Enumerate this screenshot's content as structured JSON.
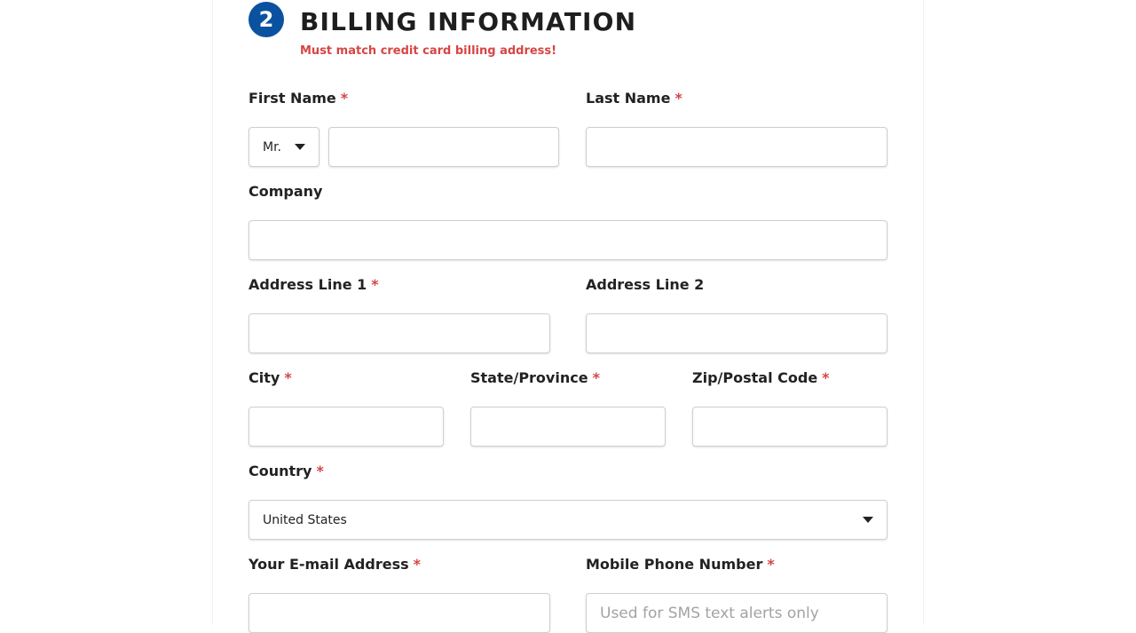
{
  "section": {
    "step": "2",
    "title": "BILLING INFORMATION",
    "note": "Must match credit card billing address!"
  },
  "required_marker": "*",
  "fields": {
    "first_name": {
      "label": "First Name",
      "required": true,
      "value": ""
    },
    "title_select": {
      "selected": "Mr."
    },
    "last_name": {
      "label": "Last Name",
      "required": true,
      "value": ""
    },
    "company": {
      "label": "Company",
      "required": false,
      "value": ""
    },
    "address1": {
      "label": "Address Line 1",
      "required": true,
      "value": ""
    },
    "address2": {
      "label": "Address Line 2",
      "required": false,
      "value": ""
    },
    "city": {
      "label": "City",
      "required": true,
      "value": ""
    },
    "state": {
      "label": "State/Province",
      "required": true,
      "value": ""
    },
    "zip": {
      "label": "Zip/Postal Code",
      "required": true,
      "value": ""
    },
    "country": {
      "label": "Country",
      "required": true,
      "selected": "United States"
    },
    "email": {
      "label": "Your E-mail Address",
      "required": true,
      "value": ""
    },
    "mobile": {
      "label": "Mobile Phone Number",
      "required": true,
      "value": "",
      "placeholder": "Used for SMS text alerts only"
    }
  },
  "colors": {
    "accent": "#0a52a0",
    "required": "#d64545",
    "border": "#cfcfcf"
  },
  "icons": {
    "dropdown": "chevron-down-icon"
  }
}
